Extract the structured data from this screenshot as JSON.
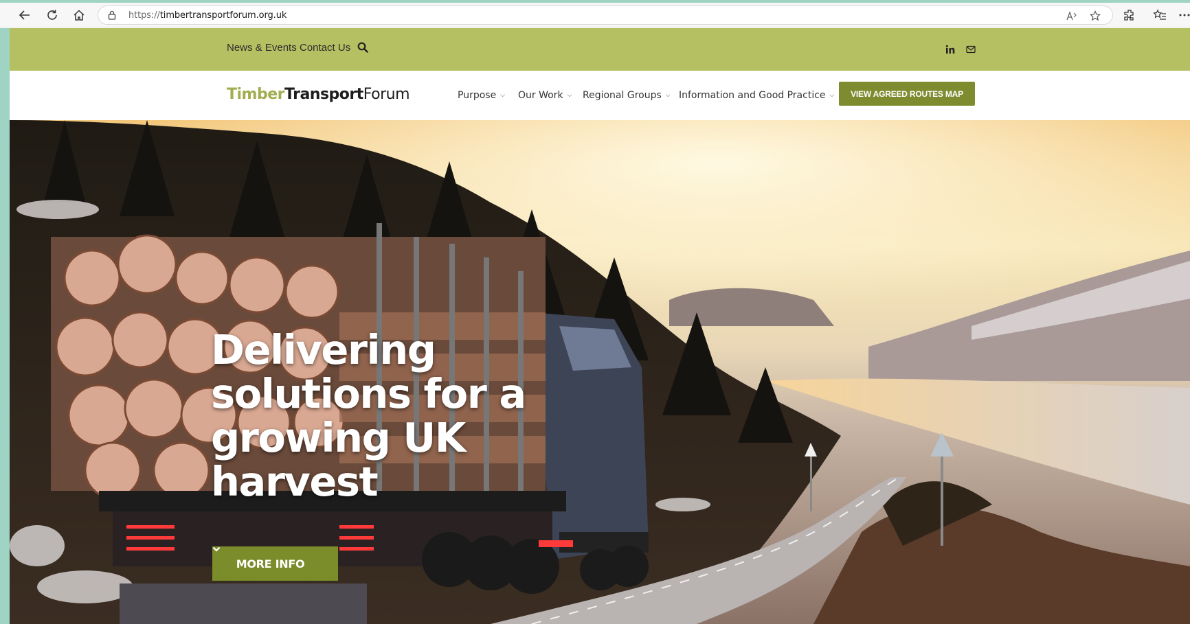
{
  "browser": {
    "url_protocol": "https://",
    "url_host": "timbertransportforum.org.uk",
    "icons": [
      "back-icon",
      "refresh-icon",
      "home-icon",
      "lock-icon",
      "read-aloud-icon",
      "favorite-star-icon",
      "extensions-icon",
      "favorites-list-icon",
      "more-icon"
    ]
  },
  "utility_bar": {
    "links": [
      "News & Events",
      "Contact Us"
    ],
    "icons": [
      "search-icon",
      "linkedin-icon",
      "email-icon"
    ],
    "background": "#b4c061"
  },
  "nav": {
    "logo": {
      "part1": "Timber",
      "part2": "Transport",
      "part3": "Forum"
    },
    "items": [
      "Purpose",
      "Our Work",
      "Regional Groups",
      "Information and Good Practice"
    ],
    "cta_label": "VIEW AGREED ROUTES MAP",
    "accent": "#7e8c2f"
  },
  "hero": {
    "headline_lines": [
      "Delivering",
      "solutions for a",
      "growing UK",
      "harvest"
    ],
    "button_label": "MORE INFO"
  }
}
